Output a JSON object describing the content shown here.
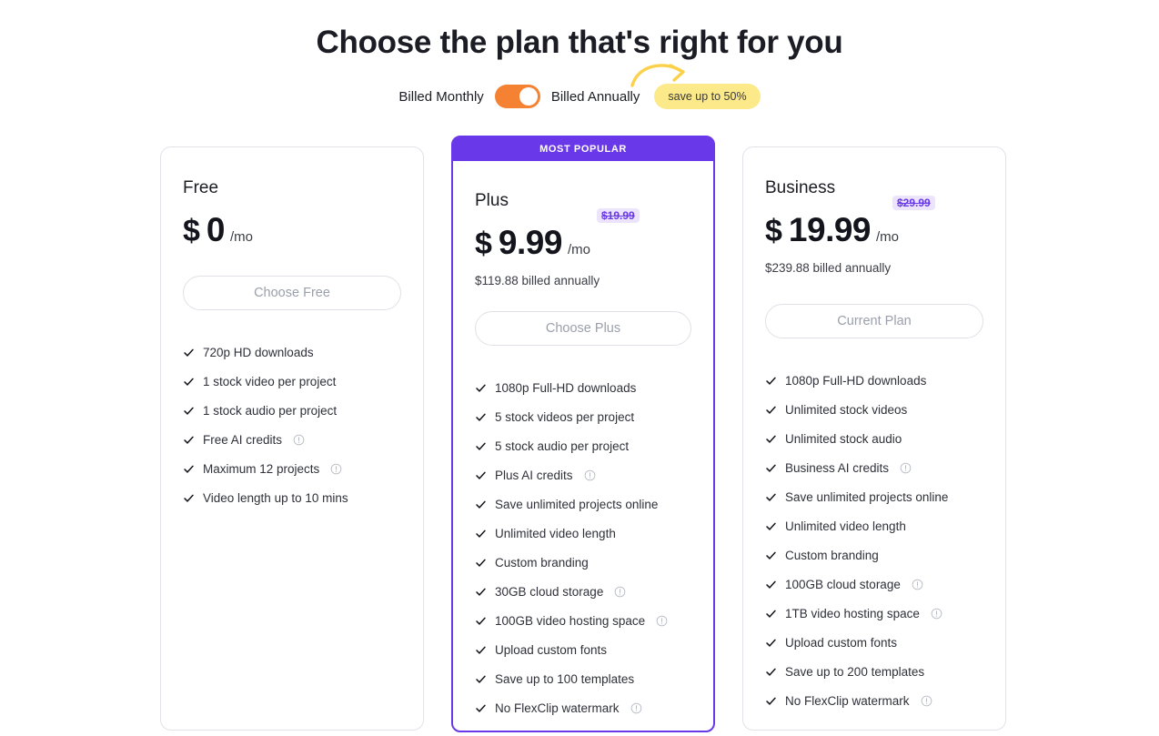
{
  "header": {
    "title": "Choose the plan that's right for you"
  },
  "billing": {
    "monthly_label": "Billed Monthly",
    "annually_label": "Billed Annually",
    "save_badge": "save up to 50%",
    "toggle_state": "annually",
    "toggle_color": "#f58233",
    "badge_color": "#fbe98a"
  },
  "accent_color": "#6938e8",
  "plans": [
    {
      "id": "free",
      "name": "Free",
      "currency": "$",
      "price": "0",
      "period": "/mo",
      "old_price": "",
      "billed_note": "",
      "cta_label": "Choose Free",
      "popular_label": "",
      "features": [
        {
          "text": "720p HD downloads",
          "info": false
        },
        {
          "text": "1 stock video per project",
          "info": false
        },
        {
          "text": "1 stock audio per project",
          "info": false
        },
        {
          "text": "Free AI credits",
          "info": true
        },
        {
          "text": "Maximum 12 projects",
          "info": true
        },
        {
          "text": "Video length up to 10 mins",
          "info": false
        }
      ]
    },
    {
      "id": "plus",
      "name": "Plus",
      "currency": "$",
      "price": "9.99",
      "period": "/mo",
      "old_price": "$19.99",
      "billed_note": "$119.88 billed annually",
      "cta_label": "Choose Plus",
      "popular_label": "MOST POPULAR",
      "features": [
        {
          "text": "1080p Full-HD downloads",
          "info": false
        },
        {
          "text": "5 stock videos per project",
          "info": false
        },
        {
          "text": "5 stock audio per project",
          "info": false
        },
        {
          "text": "Plus AI credits",
          "info": true
        },
        {
          "text": "Save unlimited projects online",
          "info": false
        },
        {
          "text": "Unlimited video length",
          "info": false
        },
        {
          "text": "Custom branding",
          "info": false
        },
        {
          "text": "30GB cloud storage",
          "info": true
        },
        {
          "text": "100GB video hosting space",
          "info": true
        },
        {
          "text": "Upload custom fonts",
          "info": false
        },
        {
          "text": "Save up to 100 templates",
          "info": false
        },
        {
          "text": "No FlexClip watermark",
          "info": true
        }
      ]
    },
    {
      "id": "business",
      "name": "Business",
      "currency": "$",
      "price": "19.99",
      "period": "/mo",
      "old_price": "$29.99",
      "billed_note": "$239.88 billed annually",
      "cta_label": "Current Plan",
      "popular_label": "",
      "features": [
        {
          "text": "1080p Full-HD downloads",
          "info": false
        },
        {
          "text": "Unlimited stock videos",
          "info": false
        },
        {
          "text": "Unlimited stock audio",
          "info": false
        },
        {
          "text": "Business AI credits",
          "info": true
        },
        {
          "text": "Save unlimited projects online",
          "info": false
        },
        {
          "text": "Unlimited video length",
          "info": false
        },
        {
          "text": "Custom branding",
          "info": false
        },
        {
          "text": "100GB cloud storage",
          "info": true
        },
        {
          "text": "1TB video hosting space",
          "info": true
        },
        {
          "text": "Upload custom fonts",
          "info": false
        },
        {
          "text": "Save up to 200 templates",
          "info": false
        },
        {
          "text": "No FlexClip watermark",
          "info": true
        }
      ]
    }
  ]
}
